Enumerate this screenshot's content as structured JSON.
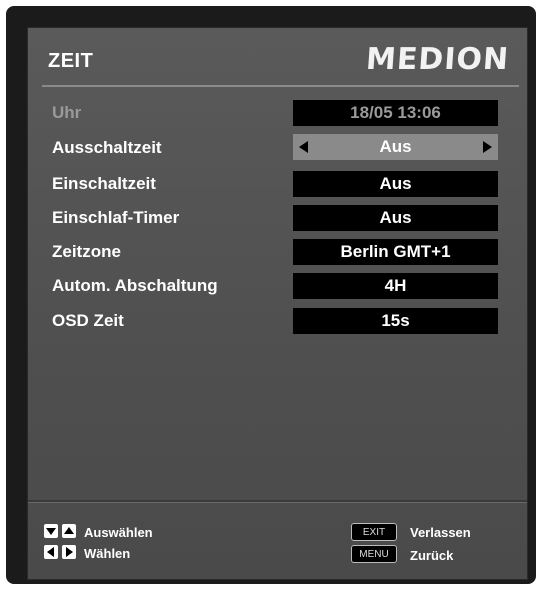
{
  "header": {
    "title": "ZEIT",
    "brand_logo": "MEDION"
  },
  "settings": [
    {
      "label": "Uhr",
      "value": "18/05   13:06",
      "state": "disabled"
    },
    {
      "label": "Ausschaltzeit",
      "value": "Aus",
      "state": "selected"
    },
    {
      "label": "Einschaltzeit",
      "value": "Aus",
      "state": "normal"
    },
    {
      "label": "Einschlaf-Timer",
      "value": "Aus",
      "state": "normal"
    },
    {
      "label": "Zeitzone",
      "value": "Berlin GMT+1",
      "state": "normal"
    },
    {
      "label": "Autom. Abschaltung",
      "value": "4H",
      "state": "normal"
    },
    {
      "label": "OSD Zeit",
      "value": "15s",
      "state": "normal"
    }
  ],
  "footer": {
    "select_hint": "Auswählen",
    "choose_hint": "Wählen",
    "exit_key": "EXIT",
    "exit_hint": "Verlassen",
    "menu_key": "MENU",
    "back_hint": "Zurück",
    "icons": [
      "down-arrow-key-icon",
      "up-arrow-key-icon",
      "left-arrow-key-icon",
      "right-arrow-key-icon"
    ]
  },
  "colors": {
    "panel_bg": "#555555",
    "value_bg": "#000000",
    "selected_bg": "#8a8a8a",
    "disabled_text": "#9a9a9a",
    "text": "#ffffff"
  }
}
